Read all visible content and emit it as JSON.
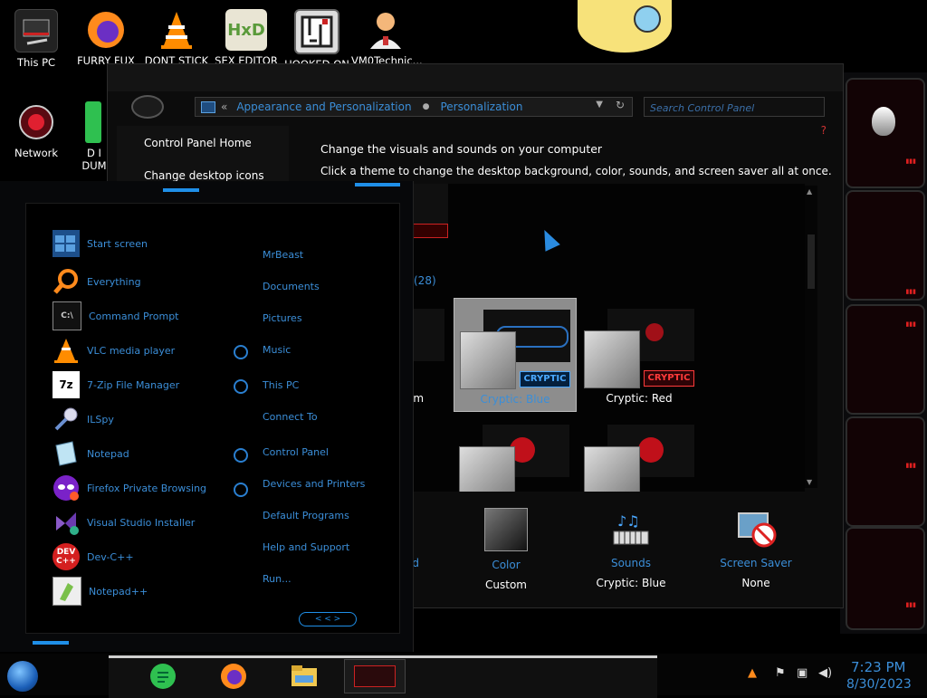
{
  "desktop_icons": [
    {
      "label": "This PC"
    },
    {
      "label": "FURRY FUX"
    },
    {
      "label": "DONT STICK"
    },
    {
      "label": "SEX EDITOR"
    },
    {
      "label": "HOOKED ON"
    },
    {
      "label": "VM0Technic..."
    },
    {
      "label": "Network"
    },
    {
      "label": "D I DUM"
    }
  ],
  "control_panel": {
    "breadcrumb_back": "«",
    "breadcrumbs": [
      "Appearance and Personalization",
      "Personalization"
    ],
    "search_placeholder": "Search Control Panel",
    "left_nav": [
      "Control Panel Home",
      "Change desktop icons"
    ],
    "help": "?",
    "heading": "Change the visuals and sounds on your computer",
    "subheading": "Click a theme to change the desktop background, color, sounds, and screen saver all at once.",
    "theme_count": "(28)",
    "themes": [
      {
        "name": "am",
        "logo": ""
      },
      {
        "name": "Cryptic: Blue",
        "logo": "CRYPTIC",
        "selected": true
      },
      {
        "name": "Cryptic: Red",
        "logo": "CRYPTIC"
      }
    ],
    "bottom": [
      {
        "title": "und",
        "value": ""
      },
      {
        "title": "Color",
        "value": "Custom"
      },
      {
        "title": "Sounds",
        "value": "Cryptic: Blue"
      },
      {
        "title": "Screen Saver",
        "value": "None"
      }
    ]
  },
  "start_menu": {
    "programs": [
      {
        "label": "Start screen",
        "icon": "start-screen-icon"
      },
      {
        "label": "Everything",
        "icon": "magnifier-icon"
      },
      {
        "label": "Command Prompt",
        "icon": "terminal-icon"
      },
      {
        "label": "VLC media player",
        "icon": "vlc-cone-icon"
      },
      {
        "label": "7-Zip File Manager",
        "icon": "7zip-icon",
        "glyph": "7z"
      },
      {
        "label": "ILSpy",
        "icon": "ilspy-icon"
      },
      {
        "label": "Notepad",
        "icon": "notepad-icon"
      },
      {
        "label": "Firefox Private Browsing",
        "icon": "firefox-private-icon"
      },
      {
        "label": "Visual Studio Installer",
        "icon": "visual-studio-icon"
      },
      {
        "label": "Dev-C++",
        "icon": "devcpp-icon",
        "glyph": "DEV C++"
      },
      {
        "label": "Notepad++",
        "icon": "notepadpp-icon"
      }
    ],
    "places": [
      "MrBeast",
      "Documents",
      "Pictures",
      "Music",
      "This PC",
      "Connect To",
      "Control Panel",
      "Devices and Printers",
      "Default Programs",
      "Help and Support",
      "Run..."
    ],
    "nav_glyph": "< < >"
  },
  "taskbar": {
    "time": "7:23 PM",
    "date": "8/30/2023",
    "colors": {
      "accent": "#3b8ed8",
      "red": "#e02020"
    }
  }
}
